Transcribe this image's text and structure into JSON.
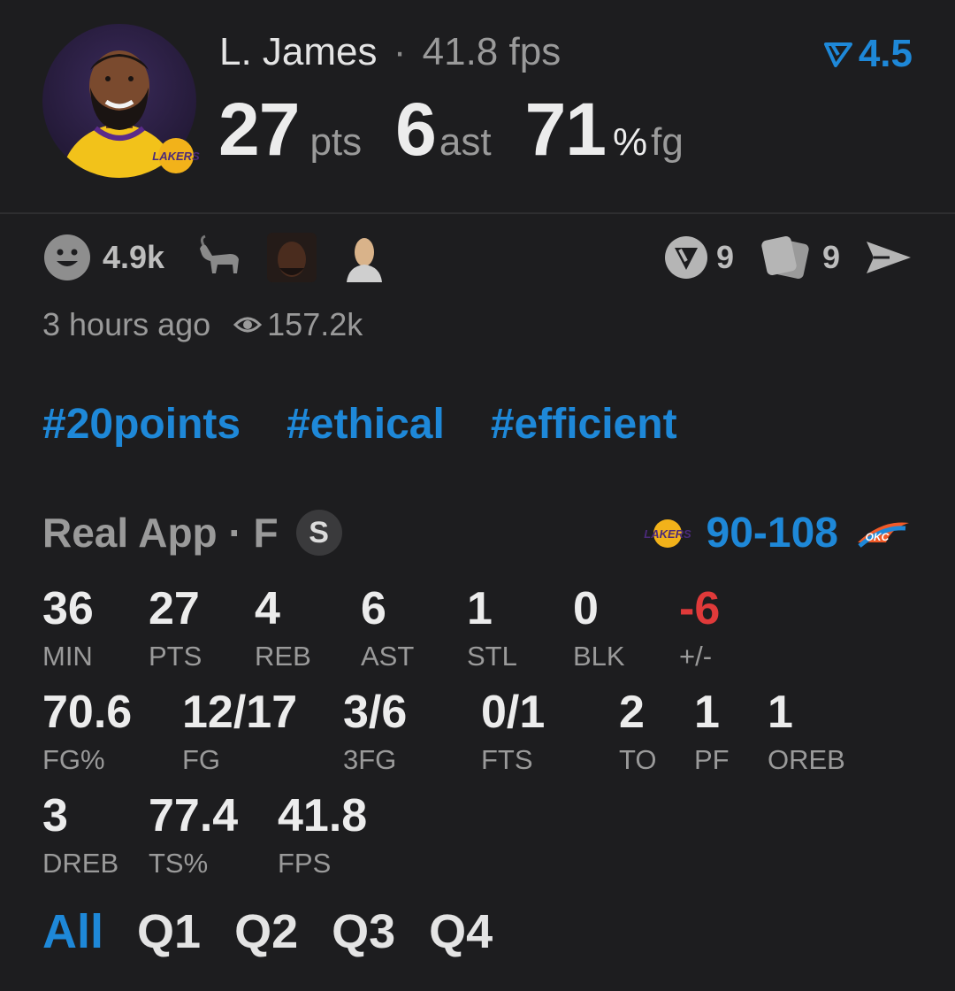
{
  "player": {
    "name": "L. James",
    "separator": "·",
    "fps_text": "41.8 fps",
    "team_logo_text": "LAKERS"
  },
  "headline": {
    "pts_value": "27",
    "pts_unit": "pts",
    "ast_value": "6",
    "ast_unit": "ast",
    "fg_value": "71",
    "fg_pct": "%",
    "fg_unit": "fg"
  },
  "rating": {
    "icon": "rating-arrow-icon",
    "value": "4.5"
  },
  "reactions": {
    "smiley_count": "4.9k",
    "emojis": [
      "goat-emoji",
      "face-emoji",
      "figure-emoji"
    ]
  },
  "actions": {
    "comments_count": "9",
    "cards_count": "9"
  },
  "meta": {
    "time_ago": "3 hours ago",
    "views": "157.2k"
  },
  "hashtags": [
    "#20points",
    "#ethical",
    "#efficient"
  ],
  "source": {
    "label": "Real App · F",
    "badge": "S"
  },
  "game": {
    "home_logo": "LAKERS",
    "score": "90-108",
    "away_logo": "OKC"
  },
  "stats": [
    {
      "value": "36",
      "label": "MIN"
    },
    {
      "value": "27",
      "label": "PTS"
    },
    {
      "value": "4",
      "label": "REB"
    },
    {
      "value": "6",
      "label": "AST"
    },
    {
      "value": "1",
      "label": "STL"
    },
    {
      "value": "0",
      "label": "BLK"
    },
    {
      "value": "-6",
      "label": "+/-"
    },
    {
      "value": "70.6",
      "label": "FG%"
    },
    {
      "value": "12/17",
      "label": "FG"
    },
    {
      "value": "3/6",
      "label": "3FG"
    },
    {
      "value": "0/1",
      "label": "FTS"
    },
    {
      "value": "2",
      "label": "TO"
    },
    {
      "value": "1",
      "label": "PF"
    },
    {
      "value": "1",
      "label": "OREB"
    },
    {
      "value": "3",
      "label": "DREB"
    },
    {
      "value": "77.4",
      "label": "TS%"
    },
    {
      "value": "41.8",
      "label": "FPS"
    }
  ],
  "tabs": [
    "All",
    "Q1",
    "Q2",
    "Q3",
    "Q4"
  ],
  "colors": {
    "accent": "#1e88d8",
    "negative": "#e03a3a",
    "background": "#1d1d1f"
  }
}
